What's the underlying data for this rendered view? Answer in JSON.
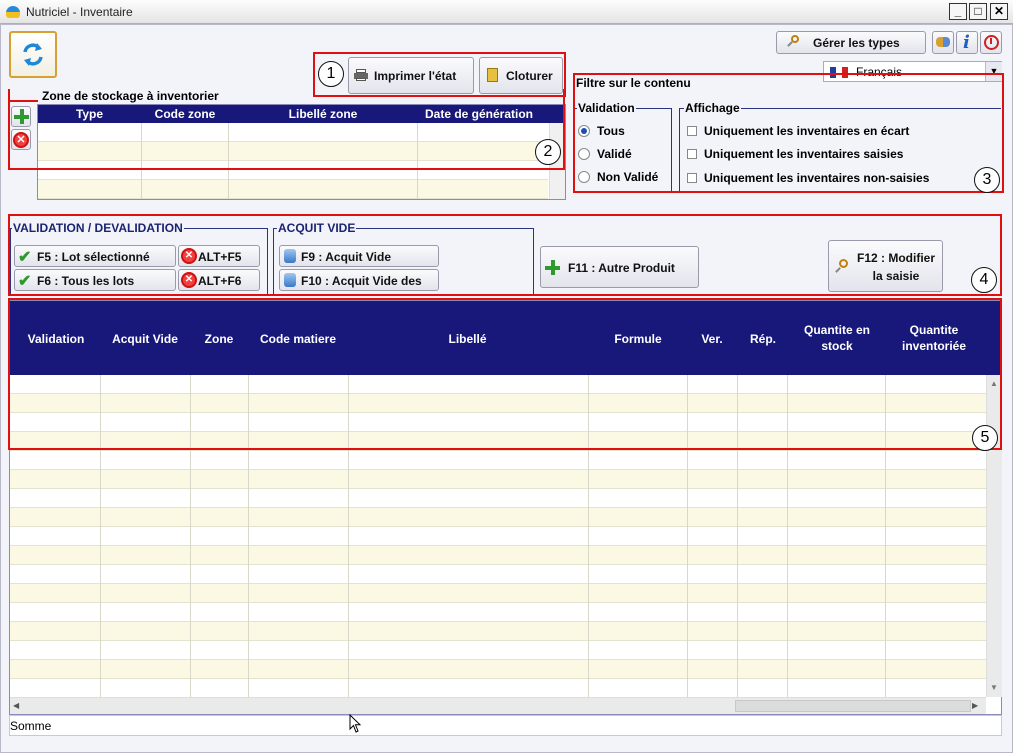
{
  "window": {
    "title": "Nutriciel - Inventaire",
    "minimize": "_",
    "maximize": "□",
    "close": "✕"
  },
  "toolbar": {
    "refresh_icon": "refresh-icon",
    "manage_types": "Gérer les types",
    "language": "Français",
    "print": "Imprimer l'état",
    "close_inv": "Cloturer"
  },
  "zone": {
    "title": "Zone de stockage à inventorier",
    "columns": [
      "Type",
      "Code zone",
      "Libellé zone",
      "Date de génération"
    ]
  },
  "filter": {
    "title": "Filtre sur le contenu",
    "validation_label": "Validation",
    "validation_options": [
      "Tous",
      "Validé",
      "Non Validé"
    ],
    "selected": "Tous",
    "display_label": "Affichage",
    "display_options": [
      "Uniquement les inventaires en écart",
      "Uniquement les inventaires saisies",
      "Uniquement les inventaires non-saisies"
    ]
  },
  "validation": {
    "label": "VALIDATION / DEVALIDATION",
    "f5": "F5 : Lot sélectionné",
    "f6": "F6 : Tous les lots",
    "alt_f5": "ALT+F5",
    "alt_f6": "ALT+F6"
  },
  "acquit": {
    "label": "ACQUIT VIDE",
    "f9": "F9 : Acquit Vide",
    "f10": "F10 : Acquit Vide des"
  },
  "actions": {
    "f11": "F11 : Autre Produit",
    "f12_line1": "F12 : Modifier",
    "f12_line2": "la saisie"
  },
  "grid": {
    "columns": [
      "Validation",
      "Acquit Vide",
      "Zone",
      "Code matiere",
      "Libellé",
      "Formule",
      "Ver.",
      "Rép.",
      "Quantite en stock",
      "Quantite inventoriée"
    ]
  },
  "footer": {
    "sum_label": "Somme"
  },
  "callouts": [
    "1",
    "2",
    "3",
    "4",
    "5"
  ],
  "colors": {
    "header": "#18187a",
    "callout": "#e01010",
    "row_alt": "#fbf9e3"
  }
}
